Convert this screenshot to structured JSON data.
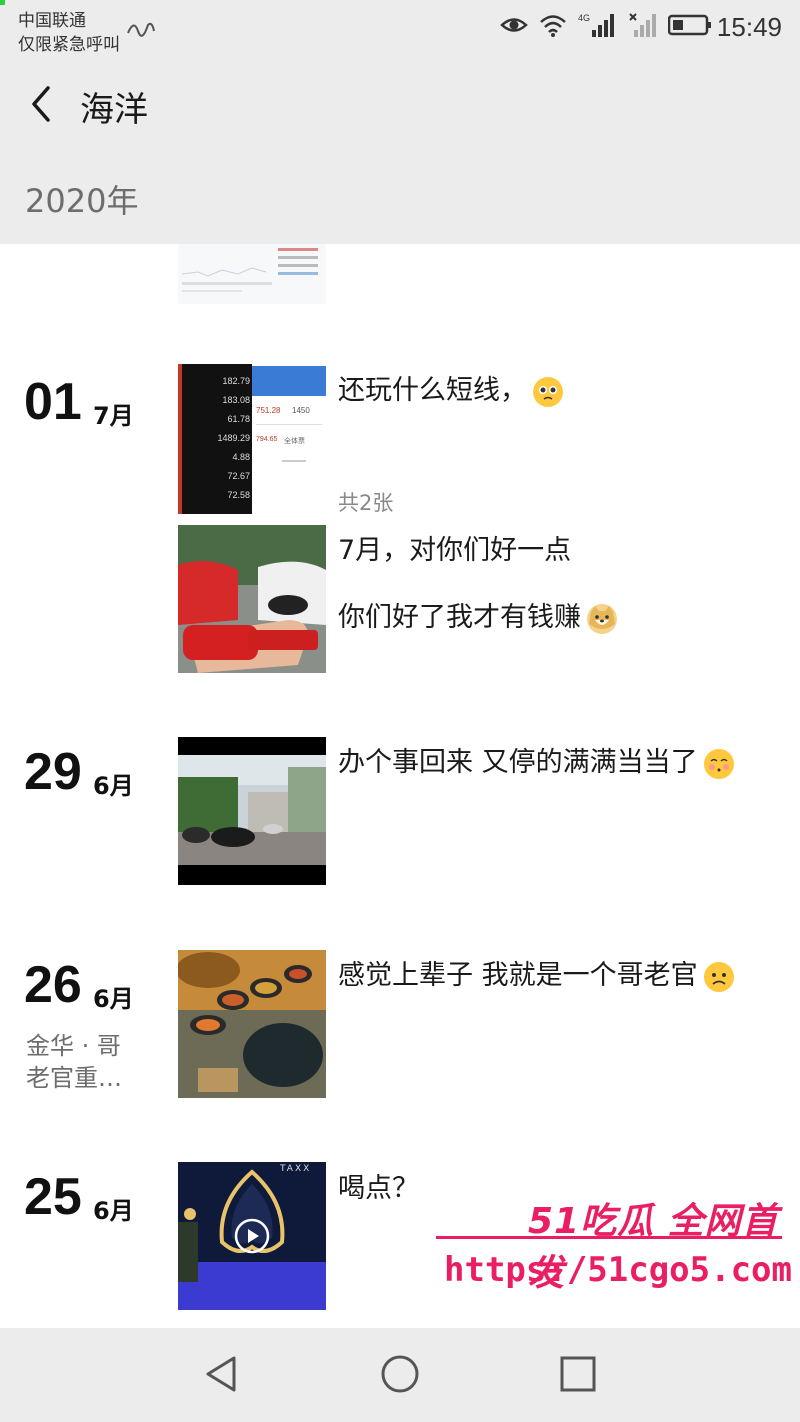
{
  "status_bar": {
    "carrier_line1": "中国联通",
    "carrier_line2": "仅限紧急呼叫",
    "time": "15:49",
    "network_label": "4G",
    "icons": [
      "eye-icon",
      "wifi-icon",
      "signal-icon",
      "no-signal-icon",
      "battery-icon"
    ]
  },
  "header": {
    "title": "海洋",
    "back_icon": "back-arrow-icon"
  },
  "year_label": "2020年",
  "posts": [
    {
      "day": "01",
      "month": "7月",
      "text": "还玩什么短线，",
      "emoji": "pleading-face",
      "count": "共2张"
    },
    {
      "day": "",
      "month": "",
      "text_line1": "7月，对你们好一点",
      "text_line2": "你们好了我才有钱赚",
      "emoji": "doge"
    },
    {
      "day": "29",
      "month": "6月",
      "text": "办个事回来 又停的满满当当了",
      "emoji": "blushing-face"
    },
    {
      "day": "26",
      "month": "6月",
      "location_line1": "金华 · 哥",
      "location_line2": "老官重…",
      "text": "感觉上辈子 我就是一个哥老官",
      "emoji": "frowning-face"
    },
    {
      "day": "25",
      "month": "6月",
      "text": "喝点？"
    }
  ],
  "thumb_text": {
    "stock_values": [
      "182.79",
      "183.08",
      "61.78",
      "1489.29",
      "4.88",
      "72.67",
      "72.58"
    ],
    "stock_right_1": "751.28",
    "stock_right_2": "1450",
    "stock_right_3": "794.65",
    "stock_right_4": "全体票",
    "bar_sign": "TAXX"
  },
  "watermark": {
    "brand": "51吃瓜 全网首发",
    "url": "https:/51cgo5.com"
  },
  "nav_bar": {
    "icons": [
      "back-triangle-icon",
      "home-circle-icon",
      "recents-square-icon"
    ]
  },
  "colors": {
    "header_bg": "#ececec",
    "watermark": "#e91e63",
    "emoji": "#ffc83d"
  }
}
